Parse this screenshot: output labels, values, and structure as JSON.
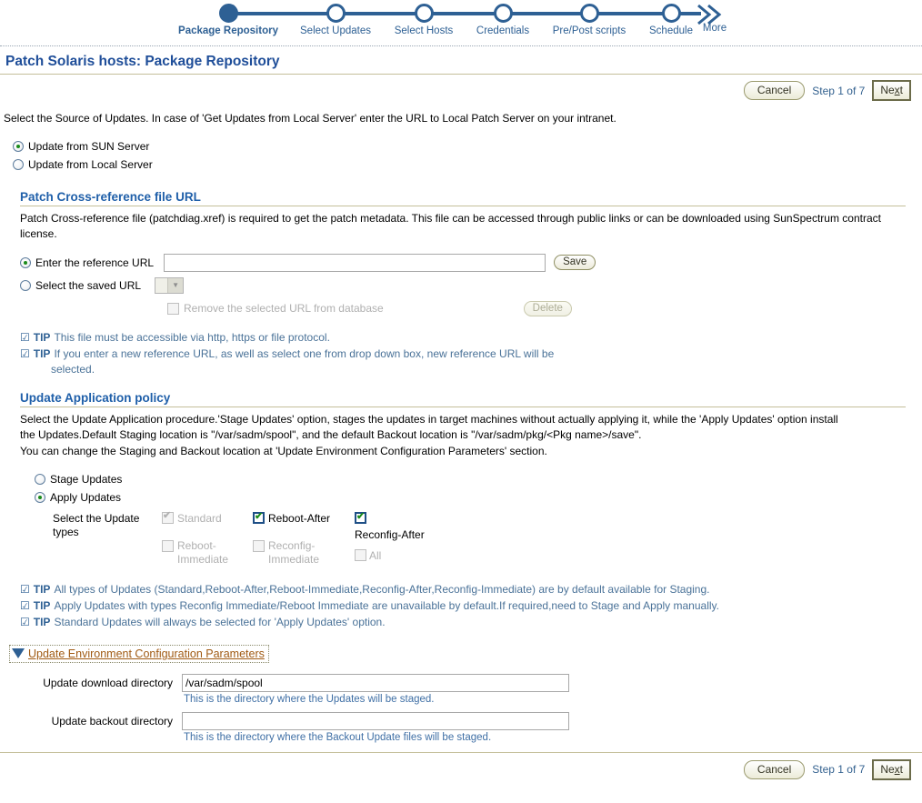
{
  "train": {
    "steps": [
      {
        "label": "Package Repository",
        "state": "current"
      },
      {
        "label": "Select Updates",
        "state": "todo"
      },
      {
        "label": "Select Hosts",
        "state": "todo"
      },
      {
        "label": "Credentials",
        "state": "todo"
      },
      {
        "label": "Pre/Post scripts",
        "state": "todo"
      },
      {
        "label": "Schedule",
        "state": "todo"
      }
    ],
    "more_label": "More"
  },
  "header": {
    "title": "Patch Solaris hosts: Package Repository",
    "cancel_label": "Cancel",
    "step_text": "Step 1 of 7",
    "next_label_pre": "Ne",
    "next_label_key": "x",
    "next_label_post": "t"
  },
  "intro": "Select the Source of Updates. In case of 'Get Updates from Local Server' enter the URL to Local Patch Server on your intranet.",
  "source": {
    "option_sun": "Update from SUN Server",
    "option_local": "Update from Local Server",
    "selected": "sun"
  },
  "xref": {
    "heading": "Patch Cross-reference file URL",
    "description": "Patch Cross-reference file (patchdiag.xref) is required to get the patch metadata. This file can be accessed through public links or can be downloaded using SunSpectrum contract license.",
    "enter_url_label": "Enter the reference URL",
    "url_value": "",
    "save_label": "Save",
    "select_saved_label": "Select the saved URL",
    "saved_url_selected": "",
    "remove_checkbox_label": "Remove the selected URL from database",
    "delete_label": "Delete",
    "tips": [
      {
        "label": "TIP",
        "text": "This file must be accessible via http, https or file protocol."
      },
      {
        "label": "TIP",
        "text": "If you enter a new reference URL, as well as select one from drop down box, new reference URL will be",
        "continuation": "selected."
      }
    ]
  },
  "policy": {
    "heading": "Update Application policy",
    "description_line1": "Select the Update Application procedure.'Stage Updates' option, stages the updates in target machines without actually applying it, while the 'Apply Updates' option install",
    "description_line2": "the Updates.Default Staging location is \"/var/sadm/spool\", and the default Backout location is \"/var/sadm/pkg/<Pkg name>/save\".",
    "description_line3": "You can change the Staging and Backout location at 'Update Environment Configuration Parameters' section.",
    "stage_label": "Stage Updates",
    "apply_label": "Apply Updates",
    "selected": "apply",
    "update_types_label": "Select the Update types",
    "types": [
      {
        "label": "Standard",
        "checked": true,
        "disabled": true
      },
      {
        "label": "Reboot-After",
        "checked": true,
        "disabled": false
      },
      {
        "label": "Reconfig-After",
        "checked": true,
        "disabled": false
      },
      {
        "label": "Reboot-Immediate",
        "checked": false,
        "disabled": true
      },
      {
        "label": "Reconfig-Immediate",
        "checked": false,
        "disabled": true
      },
      {
        "label": "All",
        "checked": false,
        "disabled": true
      }
    ],
    "tips": [
      {
        "label": "TIP",
        "text": "All types of Updates (Standard,Reboot-After,Reboot-Immediate,Reconfig-After,Reconfig-Immediate) are by default available for Staging."
      },
      {
        "label": "TIP",
        "text": "Apply Updates with types Reconfig Immediate/Reboot Immediate are unavailable by default.If required,need to Stage and Apply manually."
      },
      {
        "label": "TIP",
        "text": "Standard Updates will always be selected for 'Apply Updates' option."
      }
    ]
  },
  "env": {
    "disclosure_label": "Update Environment Configuration Parameters",
    "download_label": "Update download directory",
    "download_value": "/var/sadm/spool",
    "download_hint": "This is the directory where the Updates will be staged.",
    "backout_label": "Update backout directory",
    "backout_value": "",
    "backout_hint": "This is the directory where the Backout Update files will be staged."
  },
  "footer": {
    "cancel_label": "Cancel",
    "step_text": "Step 1 of 7",
    "next_label_pre": "Ne",
    "next_label_key": "x",
    "next_label_post": "t"
  },
  "colors": {
    "accent_blue": "#2e6094",
    "title_blue": "#1f4e99",
    "rule_khaki": "#c4bf9a",
    "tip_blue": "#4a7298",
    "link_orange": "#a05a13",
    "check_green": "#1a8b1a"
  }
}
